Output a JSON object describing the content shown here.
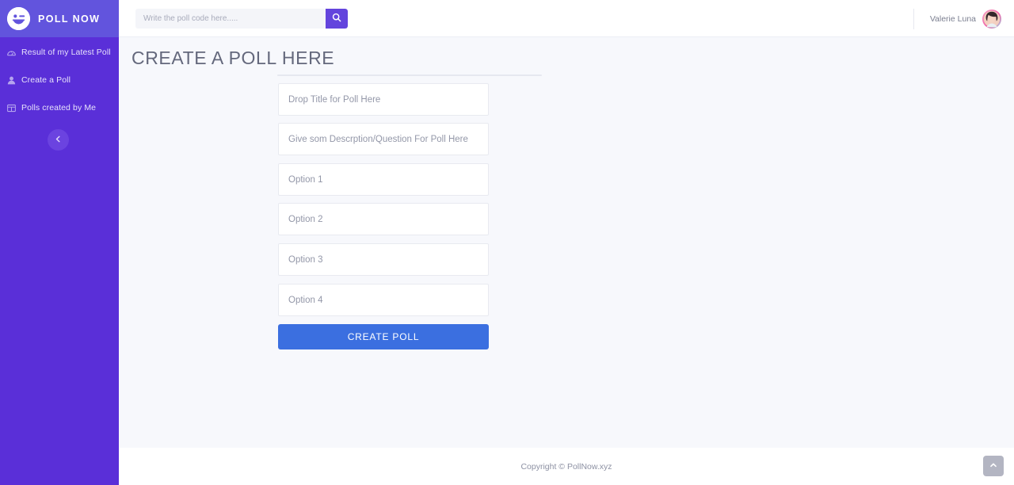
{
  "brand": {
    "name": "POLL NOW",
    "logo_icon": "wink-smiley-icon",
    "header_purple": "#6254dd",
    "sidebar_purple": "#5a2fd8"
  },
  "search": {
    "placeholder": "Write the poll code here.....",
    "value": "",
    "button_icon": "search-icon",
    "button_color": "#6344dd"
  },
  "user": {
    "name": "Valerie Luna",
    "avatar_icon": "avatar"
  },
  "sidebar": {
    "items": [
      {
        "label": "Result of my Latest Poll",
        "icon": "dashboard-icon"
      },
      {
        "label": "Create a Poll",
        "icon": "person-icon"
      },
      {
        "label": "Polls created by Me",
        "icon": "table-grid-icon"
      }
    ],
    "collapse": {
      "icon": "chevron-left-icon",
      "color": "#6b43e0"
    }
  },
  "main": {
    "title": "CREATE A POLL HERE",
    "fields": [
      {
        "name": "poll-title",
        "placeholder": "Drop Title for Poll Here",
        "value": ""
      },
      {
        "name": "poll-description",
        "placeholder": "Give som Descrption/Question For Poll Here",
        "value": ""
      },
      {
        "name": "poll-option-1",
        "placeholder": "Option 1",
        "value": ""
      },
      {
        "name": "poll-option-2",
        "placeholder": "Option 2",
        "value": ""
      },
      {
        "name": "poll-option-3",
        "placeholder": "Option 3",
        "value": ""
      },
      {
        "name": "poll-option-4",
        "placeholder": "Option 4",
        "value": ""
      }
    ],
    "submit_label": "CREATE POLL",
    "submit_color": "#3b6fe0"
  },
  "footer": {
    "copyright": "Copyright © PollNow.xyz",
    "to_top_icon": "chevron-up-icon"
  }
}
